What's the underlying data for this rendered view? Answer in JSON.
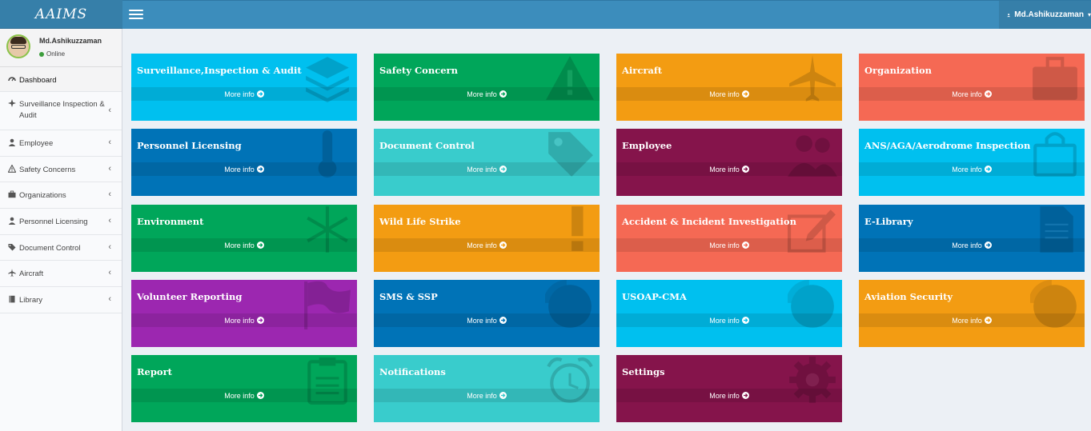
{
  "app": {
    "logo": "AAIMS",
    "user_menu_label": "Md.Ashikuzzaman",
    "user_caret": "▾"
  },
  "user_panel": {
    "name": "Md.Ashikuzzaman",
    "status": "Online"
  },
  "sidebar": {
    "items": [
      {
        "label": "Dashboard",
        "icon": "dashboard-icon"
      },
      {
        "label": "Surveillance Inspection & Audit",
        "icon": "crosshair-icon"
      },
      {
        "label": "Employee",
        "icon": "user-icon"
      },
      {
        "label": "Safety Concerns",
        "icon": "warning-icon"
      },
      {
        "label": "Organizations",
        "icon": "briefcase-icon"
      },
      {
        "label": "Personnel Licensing",
        "icon": "user-icon"
      },
      {
        "label": "Document Control",
        "icon": "tags-icon"
      },
      {
        "label": "Aircraft",
        "icon": "plane-icon"
      },
      {
        "label": "Library",
        "icon": "book-icon"
      }
    ]
  },
  "tiles_common": {
    "more_info": "More info"
  },
  "tiles": [
    {
      "title": "Surveillance,Inspection & Audit",
      "color": "#00c0ef",
      "icon": "layers-icon"
    },
    {
      "title": "Safety Concern",
      "color": "#00a65a",
      "icon": "warning-icon"
    },
    {
      "title": "Aircraft",
      "color": "#f39c12",
      "icon": "plane-icon"
    },
    {
      "title": "Organization",
      "color": "#f56954",
      "icon": "briefcase-icon"
    },
    {
      "title": "Personnel Licensing",
      "color": "#0073b7",
      "icon": "thermometer-icon"
    },
    {
      "title": "Document Control",
      "color": "#39cccc",
      "icon": "tag-icon"
    },
    {
      "title": "Employee",
      "color": "#85144b",
      "icon": "users-icon"
    },
    {
      "title": "ANS/AGA/Aerodrome Inspection",
      "color": "#00c0ef",
      "icon": "shopping-bag-icon"
    },
    {
      "title": "Environment",
      "color": "#00a65a",
      "icon": "snowflake-icon"
    },
    {
      "title": "Wild Life Strike",
      "color": "#f39c12",
      "icon": "exclamation-icon"
    },
    {
      "title": "Accident & Incident Investigation",
      "color": "#f56954",
      "icon": "edit-icon"
    },
    {
      "title": "E-Library",
      "color": "#0073b7",
      "icon": "file-text-icon"
    },
    {
      "title": "Volunteer Reporting",
      "color": "#9c27b0",
      "icon": "flag-icon"
    },
    {
      "title": "SMS & SSP",
      "color": "#0073b7",
      "icon": "pie-chart-icon"
    },
    {
      "title": "USOAP-CMA",
      "color": "#00c0ef",
      "icon": "pie-chart-icon"
    },
    {
      "title": "Aviation Security",
      "color": "#f39c12",
      "icon": "pie-chart-icon"
    },
    {
      "title": "Report",
      "color": "#00a65a",
      "icon": "clipboard-icon"
    },
    {
      "title": "Notifications",
      "color": "#39cccc",
      "icon": "alarm-clock-icon"
    },
    {
      "title": "Settings",
      "color": "#85144b",
      "icon": "gear-icon"
    }
  ]
}
